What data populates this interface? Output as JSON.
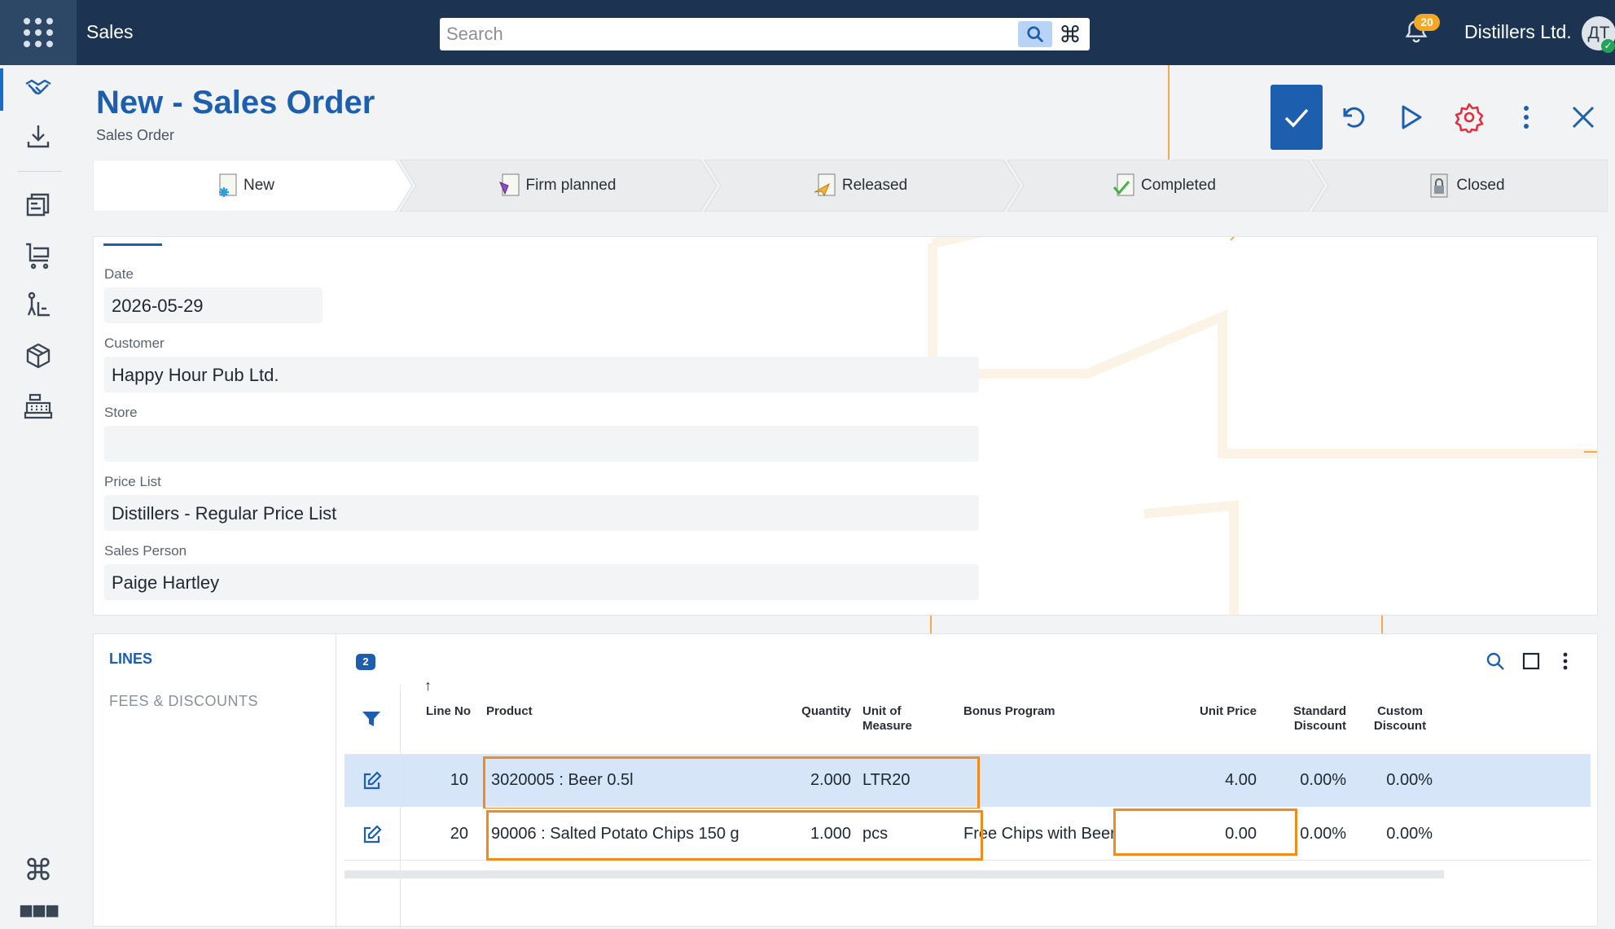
{
  "topbar": {
    "app_title": "Sales",
    "search_placeholder": "Search",
    "notification_count": "20",
    "company": "Distillers Ltd.",
    "avatar_initials": "ДТ"
  },
  "page": {
    "title": "New - Sales Order",
    "subtitle": "Sales Order"
  },
  "status_stages": [
    {
      "label": "New",
      "icon": "new-status-icon"
    },
    {
      "label": "Firm planned",
      "icon": "firm-planned-icon"
    },
    {
      "label": "Released",
      "icon": "released-icon"
    },
    {
      "label": "Completed",
      "icon": "completed-icon"
    },
    {
      "label": "Closed",
      "icon": "closed-icon"
    }
  ],
  "form": {
    "date_label": "Date",
    "date_value": "2026-05-29",
    "customer_label": "Customer",
    "customer_value": "Happy Hour Pub Ltd.",
    "store_label": "Store",
    "store_value": "",
    "price_list_label": "Price List",
    "price_list_value": "Distillers - Regular Price List",
    "sales_person_label": "Sales Person",
    "sales_person_value": "Paige Hartley"
  },
  "lines": {
    "nav_lines": "LINES",
    "nav_fees": "FEES & DISCOUNTS",
    "count": "2",
    "columns": {
      "line_no": "Line No",
      "product": "Product",
      "quantity": "Quantity",
      "uom": "Unit of Measure",
      "bonus": "Bonus Program",
      "unit_price": "Unit Price",
      "std_discount": "Standard Discount",
      "custom_discount": "Custom Discount"
    },
    "rows": [
      {
        "line_no": "10",
        "product": "3020005 : Beer 0.5l",
        "quantity": "2.000",
        "uom": "LTR20",
        "bonus": "",
        "unit_price": "4.00",
        "std_discount": "0.00%",
        "custom_discount": "0.00%"
      },
      {
        "line_no": "20",
        "product": "90006 : Salted Potato Chips 150 g",
        "quantity": "1.000",
        "uom": "pcs",
        "bonus": "Free Chips with Beer",
        "unit_price": "0.00",
        "std_discount": "0.00%",
        "custom_discount": "0.00%"
      }
    ]
  },
  "colors": {
    "topbar": "#1c3452",
    "accent": "#1d5fae",
    "highlight": "#f28a1c",
    "selected_row": "#d6e6f8"
  }
}
